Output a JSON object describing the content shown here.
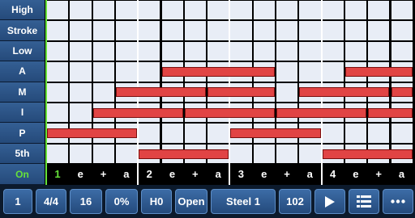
{
  "rows": [
    {
      "label": "High"
    },
    {
      "label": "Stroke"
    },
    {
      "label": "Low"
    },
    {
      "label": "A"
    },
    {
      "label": "M"
    },
    {
      "label": "I"
    },
    {
      "label": "P"
    },
    {
      "label": "5th"
    },
    {
      "label": "On"
    }
  ],
  "beats": [
    "1",
    "e",
    "+",
    "a",
    "2",
    "e",
    "+",
    "a",
    "3",
    "e",
    "+",
    "a",
    "4",
    "e",
    "+",
    "a"
  ],
  "notes": [
    {
      "row": 3,
      "start": 5,
      "end": 10
    },
    {
      "row": 3,
      "start": 13,
      "end": 16
    },
    {
      "row": 4,
      "start": 3,
      "end": 7
    },
    {
      "row": 4,
      "start": 7,
      "end": 10
    },
    {
      "row": 4,
      "start": 11,
      "end": 15
    },
    {
      "row": 4,
      "start": 15,
      "end": 16
    },
    {
      "row": 5,
      "start": 2,
      "end": 6
    },
    {
      "row": 5,
      "start": 6,
      "end": 10
    },
    {
      "row": 5,
      "start": 10,
      "end": 14
    },
    {
      "row": 5,
      "start": 14,
      "end": 16
    },
    {
      "row": 6,
      "start": 0,
      "end": 4
    },
    {
      "row": 6,
      "start": 8,
      "end": 12
    },
    {
      "row": 7,
      "start": 4,
      "end": 8
    },
    {
      "row": 7,
      "start": 12,
      "end": 16
    }
  ],
  "toolbar": {
    "measure": "1",
    "time_signature": "4/4",
    "subdivision": "16",
    "swing": "0%",
    "hold": "H0",
    "tuning": "Open",
    "instrument": "Steel 1",
    "tempo": "102",
    "play_icon": "play-icon",
    "list_icon": "list-icon",
    "more_icon": "more-icon"
  },
  "colors": {
    "note": "#e14444",
    "cell": "#e8edf6",
    "label_bg": "#2f5a8f",
    "accent_green": "#66e23a"
  }
}
